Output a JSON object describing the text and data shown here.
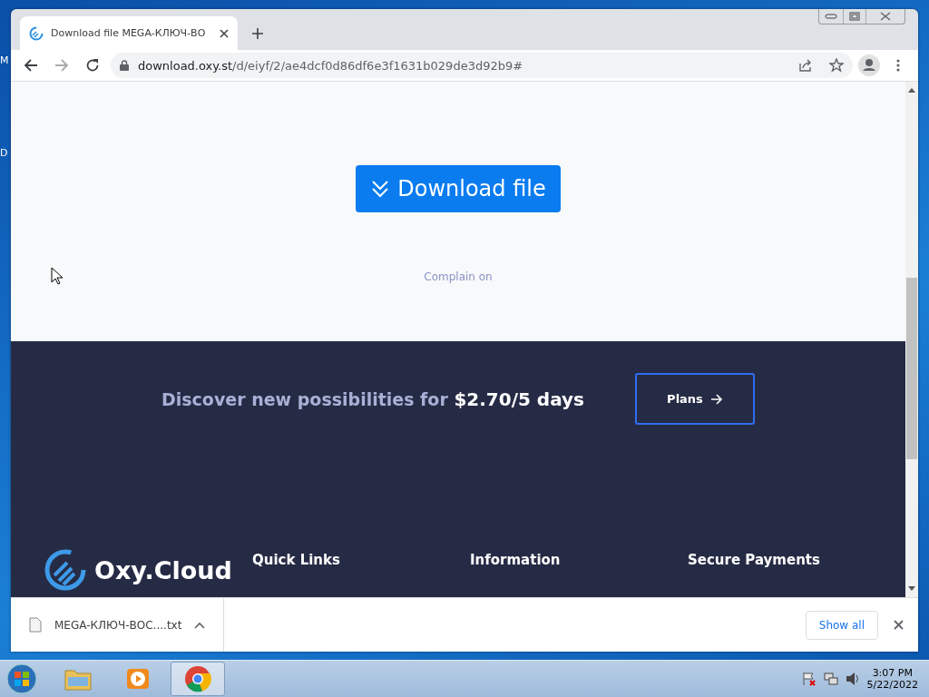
{
  "desktop_labels": [
    "M",
    "D"
  ],
  "tabs": [
    {
      "title": "Download file MEGA-КЛЮЧ-ВО",
      "selected": true
    }
  ],
  "address": {
    "host": "download.oxy.st",
    "path": "/d/eiyf/2/ae4dcf0d86df6e3f1631b029de3d92b9#"
  },
  "page": {
    "download_button": "Download file",
    "complain_link": "Complain on",
    "banner": {
      "lead": "Discover new possibilities for",
      "price": "$2.70/5 days",
      "button": "Plans"
    },
    "footer": {
      "logo": "Oxy.Cloud",
      "columns": [
        "Quick Links",
        "Information",
        "Secure Payments"
      ]
    }
  },
  "download_bar": {
    "file": "MEGA-КЛЮЧ-ВОС....txt",
    "show_all": "Show all"
  },
  "taskbar": {
    "apps": [
      {
        "kind": "folder",
        "selected": false
      },
      {
        "kind": "media",
        "selected": false
      },
      {
        "kind": "chrome",
        "selected": true
      }
    ],
    "time": "3:07 PM",
    "date": "5/22/2022"
  }
}
